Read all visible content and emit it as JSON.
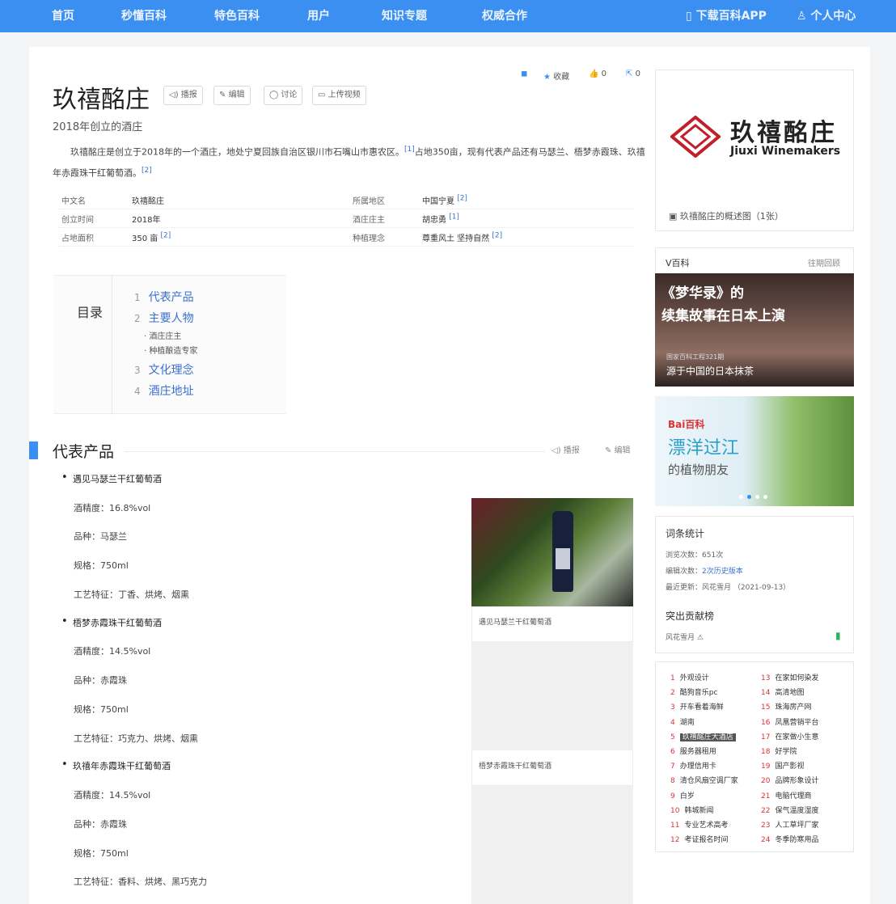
{
  "nav": {
    "items": [
      "首页",
      "秒懂百科",
      "特色百科",
      "用户",
      "知识专题",
      "权威合作"
    ],
    "download": "下载百科APP",
    "user": "个人中心"
  },
  "entry": {
    "title": "玖禧酩庄",
    "subtitle": "2018年创立的酒庄",
    "buttons": [
      "播报",
      "编辑",
      "讨论",
      "上传视频"
    ],
    "toolbar": {
      "collect": "收藏",
      "like": "0",
      "share": "0"
    },
    "summary": "玖禧酩庄是创立于2018年的一个酒庄，地处宁夏回族自治区银川市石嘴山市惠农区。",
    "summary_ref1": "[1]",
    "summary2": "占地350亩，现有代表产品还有马瑟兰、梧梦赤霞珠、玖禧年赤霞珠干红葡萄酒。",
    "summary_ref2": "[2]"
  },
  "info": [
    {
      "k1": "中文名",
      "v1": "玖禧酩庄",
      "r1": "",
      "k2": "所属地区",
      "v2": "中国宁夏",
      "r2": "[2]"
    },
    {
      "k1": "创立时间",
      "v1": "2018年",
      "r1": "",
      "k2": "酒庄庄主",
      "v2": "胡忠勇",
      "r2": "[1]"
    },
    {
      "k1": "占地面积",
      "v1": "350 亩",
      "r1": "[2]",
      "k2": "种植理念",
      "v2": "尊重风土 坚持自然",
      "r2": "[2]"
    }
  ],
  "toc": {
    "label": "目录",
    "items": [
      {
        "n": "1",
        "t": "代表产品"
      },
      {
        "n": "2",
        "t": "主要人物"
      },
      {
        "n": "3",
        "t": "文化理念"
      },
      {
        "n": "4",
        "t": "酒庄地址"
      }
    ],
    "subs": [
      "酒庄庄主",
      "种植酿造专家"
    ]
  },
  "section": {
    "title": "代表产品",
    "play": "播报",
    "edit": "编辑"
  },
  "products": [
    {
      "name": "遇见马瑟兰干红葡萄酒",
      "attrs": [
        "酒精度：16.8%vol",
        "品种：马瑟兰",
        "规格：750ml",
        "工艺特征：丁香、烘烤、烟熏"
      ]
    },
    {
      "name": "梧梦赤霞珠干红葡萄酒",
      "attrs": [
        "酒精度：14.5%vol",
        "品种：赤霞珠",
        "规格：750ml",
        "工艺特征：巧克力、烘烤、烟熏"
      ]
    },
    {
      "name": "玖禧年赤霞珠干红葡萄酒",
      "attrs": [
        "酒精度：14.5%vol",
        "品种：赤霞珠",
        "规格：750ml",
        "工艺特征：香料、烘烤、黑巧克力"
      ]
    }
  ],
  "captions": [
    "遇见马瑟兰干红葡萄酒",
    "梧梦赤霞珠干红葡萄酒"
  ],
  "sidebar": {
    "logo_cn": "玖禧酩庄",
    "logo_en": "Jiuxi Winemakers",
    "album": "玖禧酩庄的概述图（1张）",
    "vbaike": "V百科",
    "vbaike_more": "往期回顾",
    "banner1": {
      "line1": "《梦华录》的",
      "line2": "续集故事在日本上演",
      "small": "国家百科工程321期",
      "sub": "源于中国的日本抹茶"
    },
    "banner2": {
      "brand": "Bai百科",
      "line1": "漂洋过江",
      "line2": "的植物朋友"
    },
    "stats": {
      "title": "词条统计",
      "rows": [
        {
          "k": "浏览次数：",
          "v": "651次",
          "link": false
        },
        {
          "k": "编辑次数：",
          "v": "2次历史版本",
          "link": true
        },
        {
          "k": "最近更新：",
          "v": "风花雪月 （2021-09-13）",
          "link": false
        }
      ],
      "contrib": "突出贡献榜",
      "contrib_row": "风花雪月"
    },
    "rank": [
      "1 外观设计",
      "13 在家如何染发",
      "2 酷狗音乐pc",
      "14 高清地图",
      "3 开车看着海鲜",
      "15 珠海房产网",
      "4 湖南",
      "16 凤凰营销平台",
      "5 玖禧酩庄大酒店",
      "17 在家做小生意",
      "6 服务器租用",
      "18 好学院",
      "7 办理信用卡",
      "19 国产影视",
      "8 清仓风扇空调厂家",
      "20 品牌形象设计",
      "9 白岁",
      "21 电脑代理商",
      "10 韩城新闻",
      "22 保气温度湿度",
      "11 专业艺术高考",
      "23 人工草坪厂家",
      "12 考证报名时间",
      "24 冬季防寒用品"
    ]
  }
}
